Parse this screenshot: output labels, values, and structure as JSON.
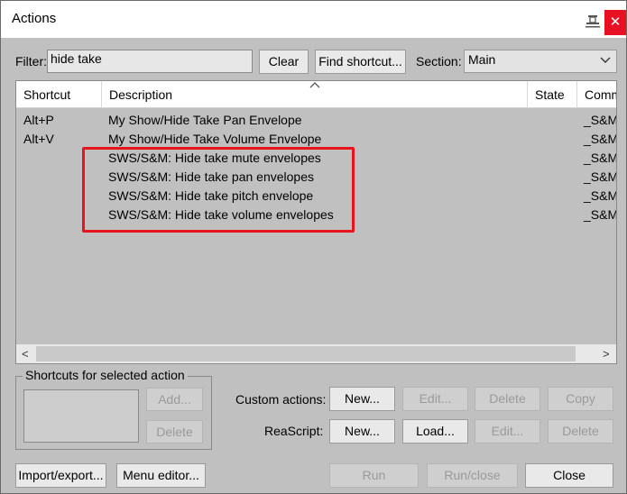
{
  "window": {
    "title": "Actions",
    "close_glyph": "✕",
    "pin_icon": "pin-icon"
  },
  "filter": {
    "label": "Filter:",
    "value": "hide take",
    "clear_label": "Clear",
    "find_shortcut_label": "Find shortcut..."
  },
  "section": {
    "label": "Section:",
    "value": "Main"
  },
  "table": {
    "columns": {
      "shortcut": "Shortcut",
      "description": "Description",
      "state": "State",
      "command": "Comm"
    },
    "rows": [
      {
        "shortcut": "Alt+P",
        "description": "My Show/Hide Take Pan Envelope",
        "state": "",
        "command": "_S&M"
      },
      {
        "shortcut": "Alt+V",
        "description": "My Show/Hide Take Volume Envelope",
        "state": "",
        "command": "_S&M"
      },
      {
        "shortcut": "",
        "description": "SWS/S&M: Hide take mute envelopes",
        "state": "",
        "command": "_S&M"
      },
      {
        "shortcut": "",
        "description": "SWS/S&M: Hide take pan envelopes",
        "state": "",
        "command": "_S&M"
      },
      {
        "shortcut": "",
        "description": "SWS/S&M: Hide take pitch envelope",
        "state": "",
        "command": "_S&M"
      },
      {
        "shortcut": "",
        "description": "SWS/S&M: Hide take volume envelopes",
        "state": "",
        "command": "_S&M"
      }
    ],
    "scroll_left": "<",
    "scroll_right": ">"
  },
  "shortcuts_group": {
    "title": "Shortcuts for selected action",
    "add_label": "Add...",
    "delete_label": "Delete"
  },
  "custom_actions": {
    "label": "Custom actions:",
    "new_label": "New...",
    "edit_label": "Edit...",
    "delete_label": "Delete",
    "copy_label": "Copy"
  },
  "reascript": {
    "label": "ReaScript:",
    "new_label": "New...",
    "load_label": "Load...",
    "edit_label": "Edit...",
    "delete_label": "Delete"
  },
  "footer": {
    "import_export_label": "Import/export...",
    "menu_editor_label": "Menu editor...",
    "run_label": "Run",
    "run_close_label": "Run/close",
    "close_label": "Close"
  },
  "colors": {
    "highlight_border": "#e8141b",
    "close_button": "#e81123"
  }
}
